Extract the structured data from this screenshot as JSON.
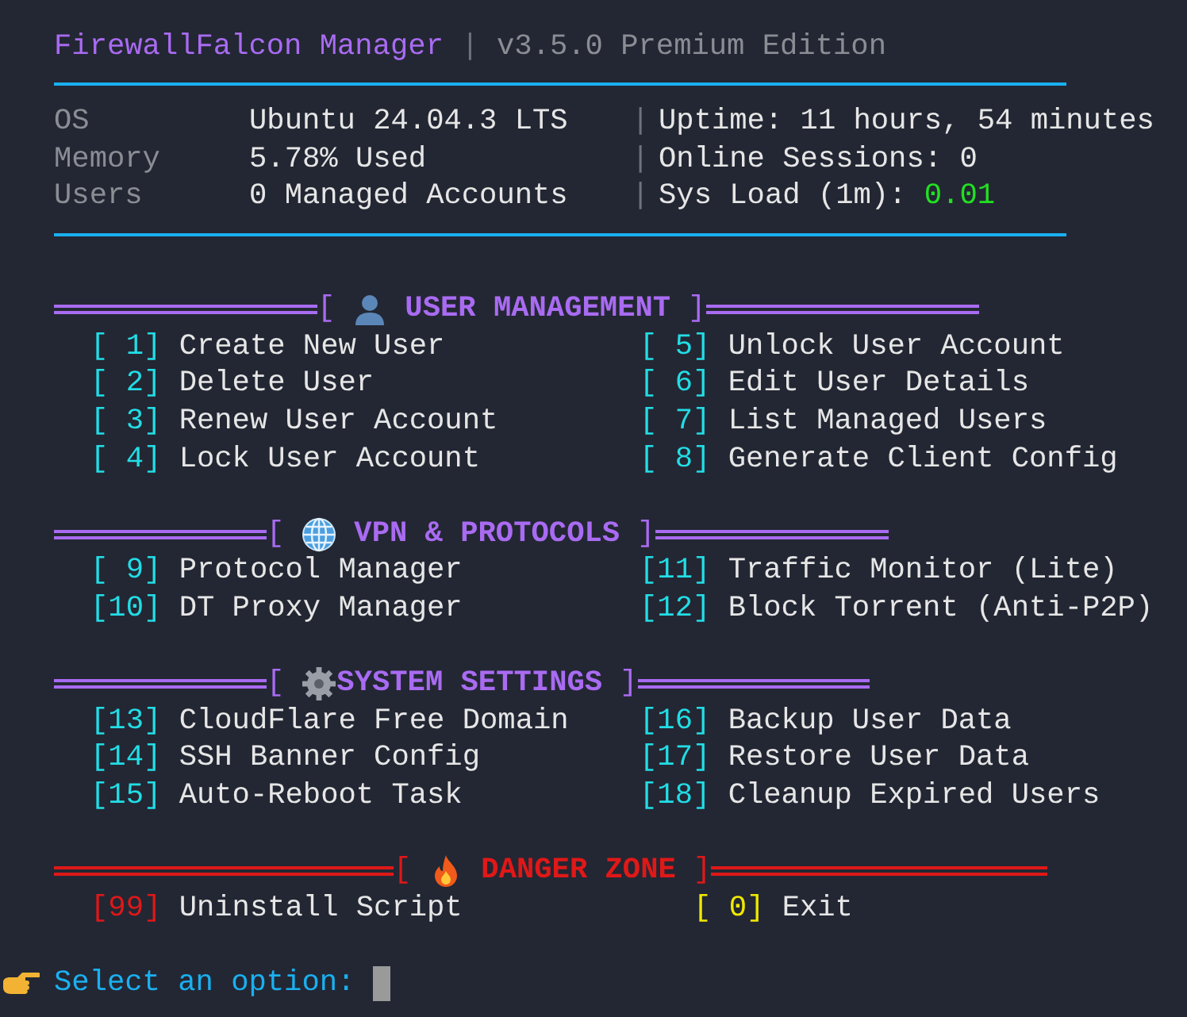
{
  "header": {
    "title": "FirewallFalcon Manager",
    "separator": "|",
    "edition": "v3.5.0 Premium Edition"
  },
  "info": [
    {
      "label": "OS",
      "value": "Ubuntu 24.04.3 LTS",
      "separator": "|",
      "right_label": "Uptime:",
      "right_value": "11 hours, 54 minutes",
      "color": "#e6e6e6"
    },
    {
      "label": "Memory",
      "value": "5.78% Used",
      "separator": "|",
      "right_label": "Online Sessions:",
      "right_value": "0",
      "color": "#e6e6e6"
    },
    {
      "label": "Users",
      "value": "0 Managed Accounts",
      "separator": "|",
      "right_label": "Sys Load (1m):",
      "right_value": "0.01",
      "color": "#22e022"
    }
  ],
  "sections": [
    {
      "kind": "user",
      "open": "[",
      "title": "USER MANAGEMENT",
      "close": "]",
      "color": "#a96bf2",
      "items": [
        {
          "number": "[ 1]",
          "label": "Create New User",
          "color": "#22dde6"
        },
        {
          "number": "[ 5]",
          "label": "Unlock User Account",
          "color": "#22dde6"
        },
        {
          "number": "[ 2]",
          "label": "Delete User",
          "color": "#22dde6"
        },
        {
          "number": "[ 6]",
          "label": "Edit User Details",
          "color": "#22dde6"
        },
        {
          "number": "[ 3]",
          "label": "Renew User Account",
          "color": "#22dde6"
        },
        {
          "number": "[ 7]",
          "label": "List Managed Users",
          "color": "#22dde6"
        },
        {
          "number": "[ 4]",
          "label": "Lock User Account",
          "color": "#22dde6"
        },
        {
          "number": "[ 8]",
          "label": "Generate Client Config",
          "color": "#22dde6"
        }
      ]
    },
    {
      "kind": "globe",
      "open": "[",
      "title": "VPN & PROTOCOLS",
      "close": "]",
      "color": "#a96bf2",
      "items": [
        {
          "number": "[ 9]",
          "label": "Protocol Manager",
          "color": "#22dde6"
        },
        {
          "number": "[11]",
          "label": "Traffic Monitor (Lite)",
          "color": "#22dde6"
        },
        {
          "number": "[10]",
          "label": "DT Proxy Manager",
          "color": "#22dde6"
        },
        {
          "number": "[12]",
          "label": "Block Torrent (Anti-P2P)",
          "color": "#22dde6"
        }
      ]
    },
    {
      "kind": "gear",
      "open": "[",
      "title": "SYSTEM SETTINGS",
      "close": "]",
      "color": "#a96bf2",
      "items": [
        {
          "number": "[13]",
          "label": "CloudFlare Free Domain",
          "color": "#22dde6"
        },
        {
          "number": "[16]",
          "label": "Backup User Data",
          "color": "#22dde6"
        },
        {
          "number": "[14]",
          "label": "SSH Banner Config",
          "color": "#22dde6"
        },
        {
          "number": "[17]",
          "label": "Restore User Data",
          "color": "#22dde6"
        },
        {
          "number": "[15]",
          "label": "Auto-Reboot Task",
          "color": "#22dde6"
        },
        {
          "number": "[18]",
          "label": "Cleanup Expired Users",
          "color": "#22dde6"
        }
      ]
    },
    {
      "kind": "fire",
      "open": "[",
      "title": "DANGER ZONE",
      "close": "]",
      "color": "#e01818",
      "items": [
        {
          "number": "[99]",
          "label": "Uninstall Script",
          "color": "#e01818"
        },
        {
          "number": "[ 0]",
          "label": "Exit",
          "color": "#f0e800"
        }
      ]
    }
  ],
  "prompt": {
    "text": "Select an option:"
  }
}
